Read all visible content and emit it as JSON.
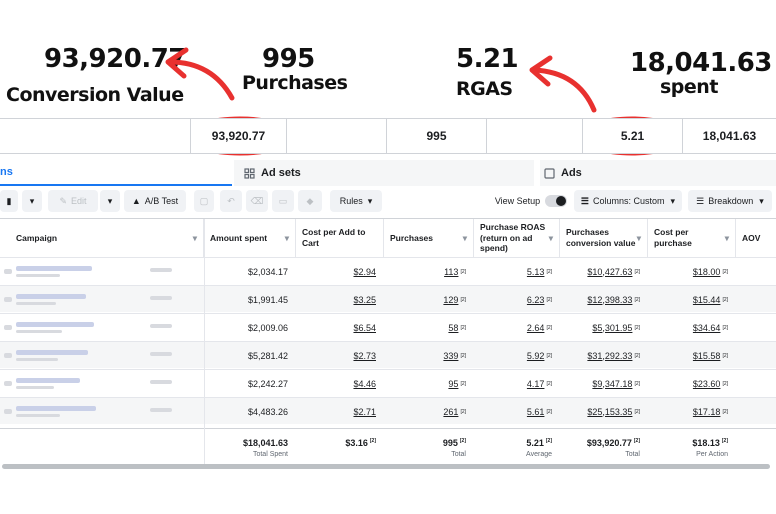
{
  "annotations": {
    "conversion_value": "93,920.77",
    "conversion_label": "Conversion Value",
    "purchases_value": "995",
    "purchases_label": "Purchases",
    "roas_value": "5.21",
    "roas_label": "RGAS",
    "spent_value": "18,041.63",
    "spent_label": "spent"
  },
  "summary": {
    "conversion_value": "93,920.77",
    "purchases": "995",
    "roas": "5.21",
    "spent": "18,041.63"
  },
  "tabs": {
    "campaigns_fragment": "ns",
    "ad_sets": "Ad sets",
    "ads": "Ads"
  },
  "toolbar": {
    "edit": "Edit",
    "ab_test": "A/B Test",
    "rules": "Rules",
    "view_setup": "View Setup",
    "columns": "Columns: Custom",
    "breakdown": "Breakdown"
  },
  "columns": {
    "campaign": "Campaign",
    "amount_spent": "Amount spent",
    "cost_per_atc": "Cost per Add to Cart",
    "purchases": "Purchases",
    "roas": "Purchase ROAS (return on ad spend)",
    "conv_value": "Purchases conversion value",
    "cost_per_purchase": "Cost per purchase",
    "aov": "AOV"
  },
  "rows": [
    {
      "spent": "$2,034.17",
      "atc": "$2.94",
      "purchases": "113",
      "roas": "5.13",
      "value": "$10,427.63",
      "cpp": "$18.00"
    },
    {
      "spent": "$1,991.45",
      "atc": "$3.25",
      "purchases": "129",
      "roas": "6.23",
      "value": "$12,398.33",
      "cpp": "$15.44"
    },
    {
      "spent": "$2,009.06",
      "atc": "$6.54",
      "purchases": "58",
      "roas": "2.64",
      "value": "$5,301.95",
      "cpp": "$34.64"
    },
    {
      "spent": "$5,281.42",
      "atc": "$2.73",
      "purchases": "339",
      "roas": "5.92",
      "value": "$31,292.33",
      "cpp": "$15.58"
    },
    {
      "spent": "$2,242.27",
      "atc": "$4.46",
      "purchases": "95",
      "roas": "4.17",
      "value": "$9,347.18",
      "cpp": "$23.60"
    },
    {
      "spent": "$4,483.26",
      "atc": "$2.71",
      "purchases": "261",
      "roas": "5.61",
      "value": "$25,153.35",
      "cpp": "$17.18"
    }
  ],
  "footnote_mark": "[2]",
  "totals": {
    "spent": "$18,041.63",
    "spent_label": "Total Spent",
    "atc": "$3.16",
    "purchases": "995",
    "purchases_label": "Total",
    "roas": "5.21",
    "roas_label": "Average",
    "value": "$93,920.77",
    "value_label": "Total",
    "cpp": "$18.13",
    "cpp_label": "Per Action"
  }
}
